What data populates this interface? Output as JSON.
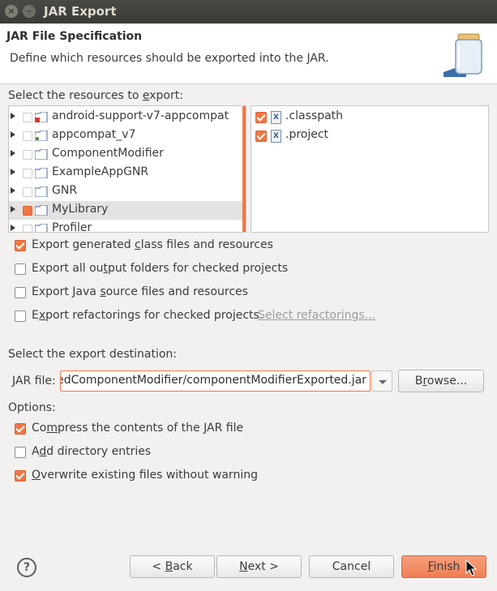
{
  "window": {
    "title": "JAR Export"
  },
  "header": {
    "title": "JAR File Specification",
    "description": "Define which resources should be exported into the JAR."
  },
  "resources": {
    "label_pre": "Select the resources to ",
    "label_u": "e",
    "label_post": "xport:",
    "projects": [
      {
        "label": "android-support-v7-appcompat",
        "checked": false,
        "selected": false
      },
      {
        "label": "appcompat_v7",
        "checked": false,
        "selected": false
      },
      {
        "label": "ComponentModifier",
        "checked": false,
        "selected": false
      },
      {
        "label": "ExampleAppGNR",
        "checked": false,
        "selected": false
      },
      {
        "label": "GNR",
        "checked": false,
        "selected": false
      },
      {
        "label": "MyLibrary",
        "checked": "partial",
        "selected": true
      },
      {
        "label": "Profiler",
        "checked": false,
        "selected": false
      }
    ],
    "files": [
      {
        "label": ".classpath",
        "checked": true,
        "icon": "x-file-icon"
      },
      {
        "label": ".project",
        "checked": true,
        "icon": "x-file-icon"
      }
    ]
  },
  "export_options": {
    "generated": {
      "pre": "Export generated ",
      "u": "c",
      "post": "lass files and resources",
      "checked": true
    },
    "output_folders": {
      "pre": "Export all ou",
      "u": "t",
      "post": "put folders for checked projects",
      "checked": false
    },
    "java_source": {
      "pre": "Export Java ",
      "u": "s",
      "post": "ource files and resources",
      "checked": false
    },
    "refactorings": {
      "pre": "E",
      "u": "x",
      "post": "port refactorings for checked projects.",
      "checked": false,
      "link": "Select refactorings..."
    }
  },
  "destination": {
    "label": "Select the export destination:",
    "jar_label_u": "J",
    "jar_label_post": "AR file:",
    "jar_value": "edComponentModifier/componentModifierExported.jar",
    "browse_pre": "B",
    "browse_u": "r",
    "browse_post": "owse..."
  },
  "options": {
    "label": "Options:",
    "compress": {
      "pre": "Co",
      "u": "m",
      "post": "press the contents of the JAR file",
      "checked": true
    },
    "directory": {
      "pre": "A",
      "u": "d",
      "post": "d directory entries",
      "checked": false
    },
    "overwrite": {
      "pre": "",
      "u": "O",
      "post": "verwrite existing files without warning",
      "checked": true
    }
  },
  "buttons": {
    "help": "?",
    "back_pre": "< ",
    "back_u": "B",
    "back_post": "ack",
    "next_pre": "",
    "next_u": "N",
    "next_post": "ext >",
    "cancel": "Cancel",
    "finish_pre": "",
    "finish_u": "F",
    "finish_post": "inish"
  },
  "colors": {
    "accent": "#f07746",
    "header_bg": "#ffffff",
    "dialog_bg": "#f2f1f0"
  }
}
